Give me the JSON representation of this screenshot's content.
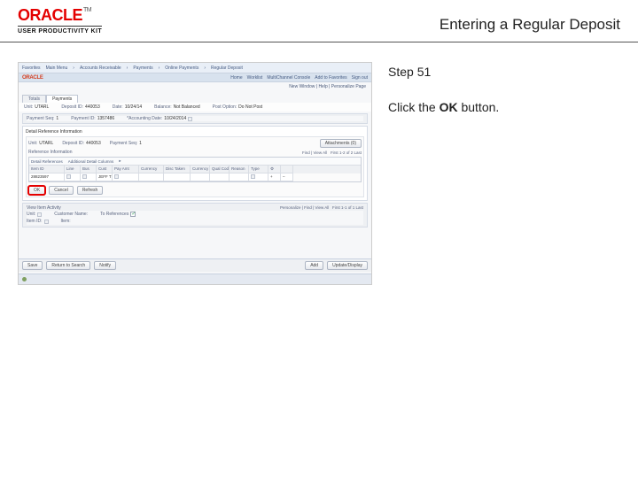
{
  "header": {
    "brand": "ORACLE",
    "brand_tm": "TM",
    "brand_sub": "USER PRODUCTIVITY KIT",
    "page_title": "Entering a Regular Deposit"
  },
  "instructions": {
    "step_label": "Step 51",
    "text_prefix": "Click the ",
    "text_bold": "OK",
    "text_suffix": " button."
  },
  "app": {
    "topmenu": [
      "Favorites",
      "Main Menu",
      "Accounts Receivable",
      "Payments",
      "Online Payments",
      "Regular Deposit"
    ],
    "brand_mini": "ORACLE",
    "nav_right": [
      "Home",
      "Worklist",
      "MultiChannel Console",
      "Add to Favorites",
      "Sign out"
    ],
    "breadcrumb_right": "New Window | Help | Personalize Page",
    "tabs": {
      "a": "Totals",
      "b": "Payments"
    },
    "deposit": {
      "unit_lbl": "Unit:",
      "unit": "UTARL",
      "depid_lbl": "Deposit ID:",
      "depid": "440053",
      "date_lbl": "Date:",
      "date": "10/24/14",
      "balance_lbl": "Balance:",
      "balance": "Not Balanced",
      "payseq_lbl": "Payment Seq:",
      "payseq": "1",
      "payid_lbl": "Payment ID:",
      "payid": "1357486",
      "acct_lbl": "*Accounting Date:",
      "acct": "10/24/2014",
      "postopt_lbl": "Post Option:",
      "postopt": "Do Not Post"
    },
    "panel_title": "Detail Reference Information",
    "panel_head": {
      "unit_lbl": "Unit:",
      "unit": "UTARL",
      "depid_lbl": "Deposit ID:",
      "depid": "440053",
      "payseq_lbl": "Payment Seq:",
      "payseq": "1",
      "attach_btn": "Attachments (0)"
    },
    "refsection": {
      "title": "Reference Information",
      "find": "Find",
      "viewall": "View All",
      "first": "First",
      "pager": "1-2 of 2",
      "last": "Last",
      "strip_a": "Detail References",
      "strip_b": "Additional Detail Columns",
      "cols": [
        "Item ID",
        "Line",
        "Bus",
        "Cust",
        "Pay Amt",
        "Currency",
        "Disc Taken",
        "Currency",
        "Qual Code",
        "Reason",
        "Type",
        "",
        ""
      ],
      "row": {
        "c0": "28823597",
        "c1": "",
        "c2": "",
        "c3": "JEFF THO",
        "c4": "",
        "c5": "",
        "c6": "",
        "c7": "",
        "c8": "",
        "c9": "",
        "c10": "",
        "c11": "+",
        "c12": "–"
      }
    },
    "btns": {
      "ok": "OK",
      "cancel": "Cancel",
      "refresh": "Refresh"
    },
    "itemactivity": {
      "title": "View Item Activity",
      "unit_lbl": "Unit:",
      "unit": "",
      "custname_lbl": "Customer Name:",
      "itemid_lbl": "Item ID:",
      "tobal_lbl": "To References",
      "allow_lbl": "Personalize | Find | View All",
      "pager": "First 1-1 of 1 Last",
      "row_lbl": "Item:"
    },
    "bottom": {
      "save": "Save",
      "prev": "Return to Search",
      "notify": "Notify",
      "add": "Add",
      "update": "Update/Display"
    }
  }
}
